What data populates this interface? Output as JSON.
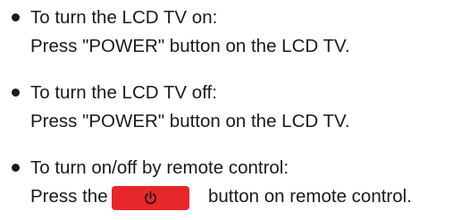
{
  "items": [
    {
      "heading": "To turn the LCD TV on:",
      "instruction": "Press \"POWER\" button on the LCD TV."
    },
    {
      "heading": "To turn the LCD TV off:",
      "instruction": "Press \"POWER\" button on the LCD TV."
    },
    {
      "heading": "To turn on/off by remote control:",
      "instruction_before": "Press the",
      "button_icon": "power-icon",
      "instruction_after": "button on remote control."
    }
  ],
  "colors": {
    "text": "#1a1a1a",
    "remote_button": "#e8272b",
    "power_icon": "#1a1a1a"
  }
}
